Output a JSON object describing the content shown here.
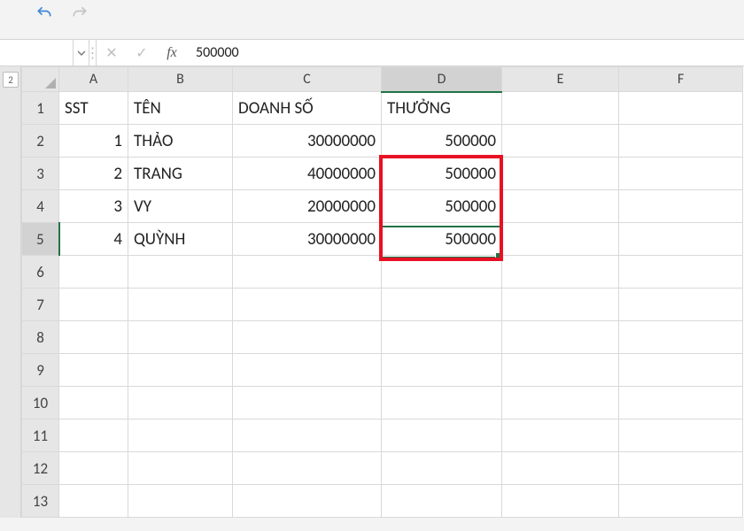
{
  "qat": {
    "mini_tab": "2"
  },
  "formula_row": {
    "name_box": "",
    "formula_value": "500000"
  },
  "columns": [
    "A",
    "B",
    "C",
    "D",
    "E",
    "F"
  ],
  "row_numbers": [
    1,
    2,
    3,
    4,
    5,
    6,
    7,
    8,
    9,
    10,
    11,
    12,
    13
  ],
  "selected_column": "D",
  "selected_row": 5,
  "headers": {
    "a": "SST",
    "b": "TÊN",
    "c": "DOANH SỐ",
    "d": "THƯỞNG"
  },
  "data_rows": [
    {
      "n": "1",
      "name": "THẢO",
      "rev": "30000000",
      "bonus": "500000"
    },
    {
      "n": "2",
      "name": "TRANG",
      "rev": "40000000",
      "bonus": "500000"
    },
    {
      "n": "3",
      "name": "VY",
      "rev": "20000000",
      "bonus": "500000"
    },
    {
      "n": "4",
      "name": "QUỲNH",
      "rev": "30000000",
      "bonus": "500000"
    }
  ],
  "chart_data": {
    "type": "table",
    "columns": [
      "SST",
      "TÊN",
      "DOANH SỐ",
      "THƯỞNG"
    ],
    "rows": [
      [
        1,
        "THẢO",
        30000000,
        500000
      ],
      [
        2,
        "TRANG",
        40000000,
        500000
      ],
      [
        3,
        "VY",
        20000000,
        500000
      ],
      [
        4,
        "QUỲNH",
        30000000,
        500000
      ]
    ]
  }
}
